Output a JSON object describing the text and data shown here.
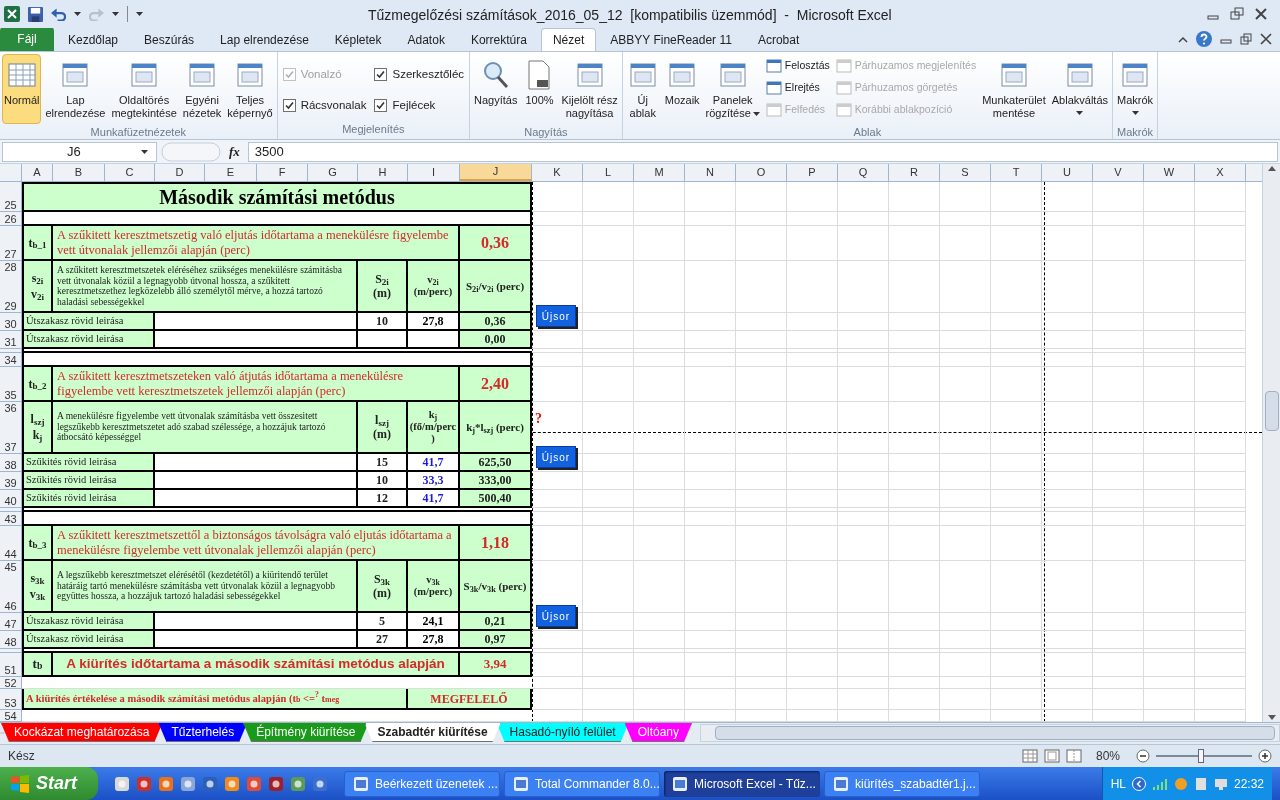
{
  "window": {
    "title": "Tűzmegelőzési számítások_2016_05_12  [kompatibilis üzemmód]  -  Microsoft Excel"
  },
  "ribbon_tabs": [
    {
      "label": "Fájl",
      "kind": "file",
      "selected": false
    },
    {
      "label": "Kezdőlap",
      "kind": "tab",
      "selected": false
    },
    {
      "label": "Beszúrás",
      "kind": "tab",
      "selected": false
    },
    {
      "label": "Lap elrendezése",
      "kind": "tab",
      "selected": false
    },
    {
      "label": "Képletek",
      "kind": "tab",
      "selected": false
    },
    {
      "label": "Adatok",
      "kind": "tab",
      "selected": false
    },
    {
      "label": "Korrektúra",
      "kind": "tab",
      "selected": false
    },
    {
      "label": "Nézet",
      "kind": "tab",
      "selected": true
    },
    {
      "label": "ABBYY FineReader 11",
      "kind": "tab",
      "selected": false
    },
    {
      "label": "Acrobat",
      "kind": "tab",
      "selected": false
    }
  ],
  "ribbon": {
    "groups": [
      {
        "label": "Munkafüzetnézetek",
        "stacks": [
          [
            {
              "kind": "large",
              "lines": [
                "Normál"
              ],
              "selected": true
            }
          ],
          [
            {
              "kind": "large",
              "lines": [
                "Lap",
                "elrendezése"
              ],
              "selected": false
            }
          ],
          [
            {
              "kind": "large",
              "lines": [
                "Oldaltörés",
                "megtekintése"
              ],
              "selected": false
            }
          ],
          [
            {
              "kind": "large",
              "lines": [
                "Egyéni",
                "nézetek"
              ],
              "selected": false
            }
          ],
          [
            {
              "kind": "large",
              "lines": [
                "Teljes",
                "képernyő"
              ],
              "selected": false
            }
          ]
        ]
      },
      {
        "label": "Megjelenítés",
        "stacks": [
          [
            {
              "kind": "check",
              "label": "Vonalzó",
              "checked": true,
              "disabled": true
            },
            {
              "kind": "check",
              "label": "Rácsvonalak",
              "checked": true,
              "disabled": false
            }
          ],
          [
            {
              "kind": "check",
              "label": "Szerkesztőléc",
              "checked": true,
              "disabled": false
            },
            {
              "kind": "check",
              "label": "Fejlécek",
              "checked": true,
              "disabled": false
            }
          ]
        ]
      },
      {
        "label": "Nagyítás",
        "stacks": [
          [
            {
              "kind": "large",
              "lines": [
                "Nagyítás"
              ]
            }
          ],
          [
            {
              "kind": "large",
              "lines": [
                "100%"
              ]
            }
          ],
          [
            {
              "kind": "large",
              "lines": [
                "Kijelölt rész",
                "nagyítása"
              ]
            }
          ]
        ]
      },
      {
        "label": "Ablak",
        "stacks": [
          [
            {
              "kind": "large",
              "lines": [
                "Új",
                "ablak"
              ]
            }
          ],
          [
            {
              "kind": "large",
              "lines": [
                "Mozaik"
              ]
            }
          ],
          [
            {
              "kind": "large",
              "lines": [
                "Panelek",
                "rögzítése"
              ],
              "dropdown": true
            }
          ],
          [
            {
              "kind": "small",
              "label": "Felosztás",
              "disabled": false
            },
            {
              "kind": "small",
              "label": "Elrejtés",
              "disabled": false
            },
            {
              "kind": "small",
              "label": "Felfedés",
              "disabled": true
            }
          ],
          [
            {
              "kind": "small",
              "label": "Párhuzamos megjelenítés",
              "disabled": true
            },
            {
              "kind": "small",
              "label": "Párhuzamos görgetés",
              "disabled": true
            },
            {
              "kind": "small",
              "label": "Korábbi ablakpozíció",
              "disabled": true
            }
          ],
          [
            {
              "kind": "large",
              "lines": [
                "Munkaterület",
                "mentése"
              ]
            }
          ],
          [
            {
              "kind": "large",
              "lines": [
                "Ablakváltás"
              ],
              "dropdown": true
            }
          ]
        ]
      },
      {
        "label": "Makrók",
        "stacks": [
          [
            {
              "kind": "large",
              "lines": [
                "Makrók"
              ],
              "dropdown": true
            }
          ]
        ]
      }
    ]
  },
  "formula_bar": {
    "name_box": "J6",
    "function_label": "fx",
    "value": "3500"
  },
  "sheet": {
    "columns": [
      {
        "label": "A",
        "selected": false
      },
      {
        "label": "B",
        "selected": false
      },
      {
        "label": "C",
        "selected": false
      },
      {
        "label": "D",
        "selected": false
      },
      {
        "label": "E",
        "selected": false
      },
      {
        "label": "F",
        "selected": false
      },
      {
        "label": "G",
        "selected": false
      },
      {
        "label": "H",
        "selected": false
      },
      {
        "label": "I",
        "selected": false
      },
      {
        "label": "J",
        "selected": true
      },
      {
        "label": "K",
        "selected": false
      },
      {
        "label": "L",
        "selected": false
      },
      {
        "label": "M",
        "selected": false
      },
      {
        "label": "N",
        "selected": false
      },
      {
        "label": "O",
        "selected": false
      },
      {
        "label": "P",
        "selected": false
      },
      {
        "label": "Q",
        "selected": false
      },
      {
        "label": "R",
        "selected": false
      },
      {
        "label": "S",
        "selected": false
      },
      {
        "label": "T",
        "selected": false
      },
      {
        "label": "U",
        "selected": false
      },
      {
        "label": "V",
        "selected": false
      },
      {
        "label": "W",
        "selected": false
      },
      {
        "label": "X",
        "selected": false
      }
    ],
    "blocks": [
      {
        "kind": "title",
        "rows": [
          "25"
        ],
        "text": "Második számítási metódus"
      },
      {
        "kind": "blank",
        "rows": [
          "26"
        ]
      },
      {
        "kind": "section",
        "rows": [
          "27"
        ],
        "symbol": "t$_{b_1}$",
        "text": "A szűkitett keresztmetszetig való eljutás időtartama a menekülésre figyelembe vett útvonalak jellemzői alapján (perc)",
        "value": "0,36"
      },
      {
        "kind": "desc",
        "rows": [
          "28",
          "29"
        ],
        "symbol_lines": [
          "s$_{2i}$",
          "v$_{2i}$"
        ],
        "text": "A szűkitett keresztmetszetek eléréséhez szükséges menekülésre számitásba vett útvonalak közül a legnagyobb útvonal hossza, a szűkitett keresztmetszethez legközelebb álló személytől mérve, a hozzá tartozó haladási sebességekkel",
        "h": [
          "S$_{2i}$",
          "(m)"
        ],
        "i": [
          "v$_{2i}$",
          "(m/perc)"
        ],
        "j": [
          "S$_{2i}$/v$_{2i}$ (perc)"
        ],
        "button": "Újsor"
      },
      {
        "kind": "data",
        "rows": [
          "30"
        ],
        "label": "Útszakasz rövid leirása",
        "h": "10",
        "i": "27,8",
        "i_input": false,
        "j": "0,36"
      },
      {
        "kind": "data",
        "rows": [
          "31"
        ],
        "label": "Útszakasz rövid leirása",
        "j": "0,00"
      },
      {
        "kind": "gap"
      },
      {
        "kind": "blank",
        "rows": [
          "34"
        ]
      },
      {
        "kind": "section",
        "rows": [
          "35"
        ],
        "symbol": "t$_{b_2}$",
        "text": "A szűkitett keresztmetszeteken való átjutás időtartama a menekülésre figyelembe vett keresztmetszetek jellemzői alapján (perc)",
        "value": "2,40"
      },
      {
        "kind": "desc",
        "rows": [
          "36",
          "37"
        ],
        "symbol_lines": [
          "l$_{szj}$",
          "k$_{j}$"
        ],
        "text": "A menekülésre figyelembe vett útvonalak számításba vett összesitett legszűkebb keresztmetszetet adó szabad szélessége, a hozzájuk tartozó átbocsátó képességgel",
        "h": [
          "l$_{szj}$",
          "(m)"
        ],
        "i": [
          "k$_{j}$",
          "(fő/m/perc",
          ")"
        ],
        "j": [
          "k$_{j}$*l$_{szj}$ (perc)"
        ],
        "button": "Újsor",
        "note_mark": "?"
      },
      {
        "kind": "data",
        "rows": [
          "38"
        ],
        "label": "Szűkités rövid leirása",
        "h": "15",
        "i": "41,7",
        "i_input": true,
        "j": "625,50"
      },
      {
        "kind": "data",
        "rows": [
          "39"
        ],
        "label": "Szűkités rövid leirása",
        "h": "10",
        "i": "33,3",
        "i_input": true,
        "j": "333,00"
      },
      {
        "kind": "data",
        "rows": [
          "40"
        ],
        "label": "Szűkités rövid leirása",
        "h": "12",
        "i": "41,7",
        "i_input": true,
        "j": "500,40"
      },
      {
        "kind": "gap"
      },
      {
        "kind": "blank",
        "rows": [
          "43"
        ]
      },
      {
        "kind": "section",
        "rows": [
          "44"
        ],
        "symbol": "t$_{b_3}$",
        "text": "A szűkitett keresztmetszettől a biztonságos távolságra való eljutás időtartama a menekülésre figyelembe vett útvonalak jellemzői alapján (perc)",
        "value": "1,18"
      },
      {
        "kind": "desc",
        "rows": [
          "45",
          "46"
        ],
        "symbol_lines": [
          "s$_{3k}$",
          "v$_{3k}$"
        ],
        "text": "A legszűkebb keresztmetszet elérésétől (kezdetétől) a kiüritendő terület határáig tartó menekülésre számításba vett útvonalak közül a legnagyobb együttes hossza, a hozzájuk tartozó haladási sebességekkel",
        "h": [
          "S$_{3k}$",
          "(m)"
        ],
        "i": [
          "v$_{3k}$",
          "(m/perc)"
        ],
        "j": [
          "S$_{3k}$/v$_{3k}$ (perc)"
        ],
        "button": "Újsor"
      },
      {
        "kind": "data",
        "rows": [
          "47"
        ],
        "label": "Útszakasz rövid leirása",
        "h": "5",
        "i": "24,1",
        "i_input": false,
        "j": "0,21"
      },
      {
        "kind": "data",
        "rows": [
          "48"
        ],
        "label": "Útszakasz rövid leirása",
        "h": "27",
        "i": "27,8",
        "i_input": false,
        "j": "0,97"
      },
      {
        "kind": "gap"
      },
      {
        "kind": "total",
        "rows": [
          "51"
        ],
        "symbol": "t$_{b}$",
        "text": "A kiürítés időtartama a második számítási metódus alapján",
        "value": "3,94"
      },
      {
        "kind": "empty",
        "rows": [
          "52"
        ]
      },
      {
        "kind": "verdict",
        "rows": [
          "53"
        ],
        "text": "A kiürítés értékelése a második számítási metódus alapján (t$_{b}$ <=$^{?}$ t$_{meg}$",
        "value": "MEGFELELŐ"
      },
      {
        "kind": "empty",
        "rows": [
          "54"
        ]
      }
    ]
  },
  "sheet_tabs": [
    {
      "label": "Kockázat meghatározása",
      "color": "#ff0000",
      "selected": false
    },
    {
      "label": "Tűzterhelés",
      "color": "#0000ff",
      "selected": false
    },
    {
      "label": "Építmény kiürítése",
      "color": "#1a9a1a",
      "selected": false
    },
    {
      "label": "Szabadtér kiürítése",
      "color": "#ffffff",
      "selected": true
    },
    {
      "label": "Hasadó-nyíló felület",
      "color": "#00ffff",
      "selected": false
    },
    {
      "label": "Oltóany",
      "color": "#ff00ff",
      "selected": false
    }
  ],
  "status_bar": {
    "text": "Kész",
    "zoom": "80%",
    "level": 0.47
  },
  "taskbar": {
    "start": "Start",
    "tasks": [
      {
        "label": "Beérkezett üzenetek ...",
        "selected": false
      },
      {
        "label": "Total Commander 8.0...",
        "selected": false
      },
      {
        "label": "Microsoft Excel - Tűz...",
        "selected": true
      },
      {
        "label": "kiürítés_szabadtér1.j...",
        "selected": false
      }
    ],
    "language": "HL",
    "time": "22:32"
  }
}
